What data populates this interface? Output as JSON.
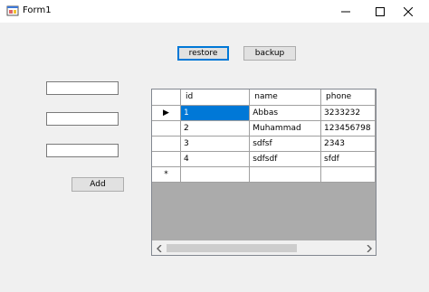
{
  "window": {
    "title": "Form1"
  },
  "buttons": {
    "restore": "restore",
    "backup": "backup",
    "add": "Add"
  },
  "inputs": [
    {
      "value": ""
    },
    {
      "value": ""
    },
    {
      "value": ""
    }
  ],
  "grid": {
    "columns": [
      "id",
      "name",
      "phone"
    ],
    "rows": [
      [
        "1",
        "Abbas",
        "3233232"
      ],
      [
        "2",
        "Muhammad",
        "123456798"
      ],
      [
        "3",
        "sdfsf",
        "2343"
      ],
      [
        "4",
        "sdfsdf",
        "sfdf"
      ]
    ],
    "current_row_marker": "▶",
    "new_row_marker": "*",
    "selected_cell": "row 1, column id"
  },
  "colors": {
    "selection": "#0078d7",
    "grid_background": "#ababab",
    "form_background": "#f0f0f0"
  }
}
